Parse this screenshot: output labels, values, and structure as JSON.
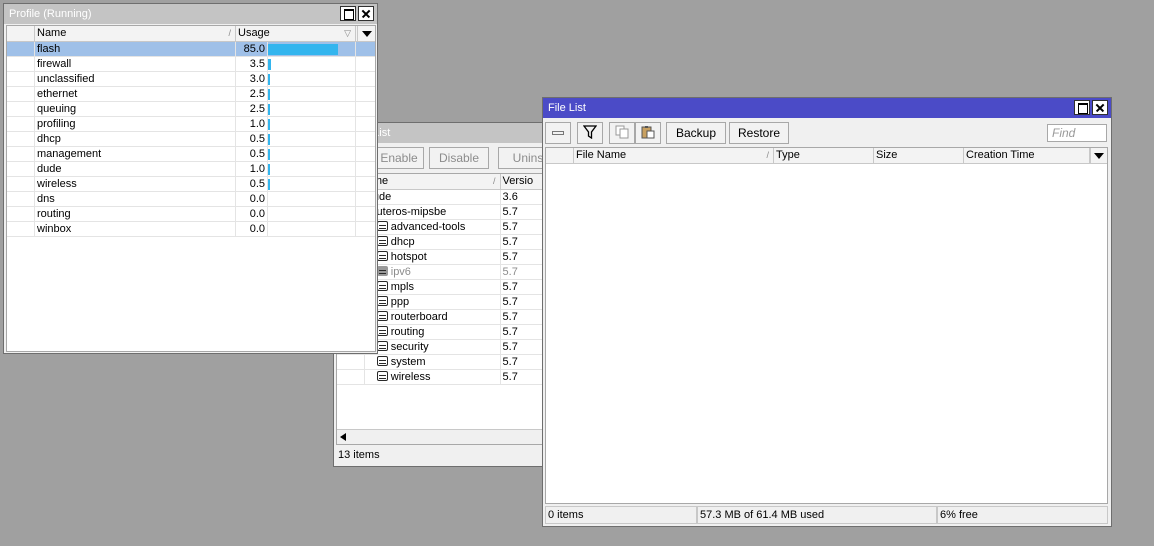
{
  "profile": {
    "title": "Profile (Running)",
    "columns": [
      "Name",
      "Usage"
    ],
    "rows": [
      {
        "name": "flash",
        "usage": "85.0",
        "pct": 85.0,
        "selected": true
      },
      {
        "name": "firewall",
        "usage": "3.5",
        "pct": 3.5
      },
      {
        "name": "unclassified",
        "usage": "3.0",
        "pct": 3.0
      },
      {
        "name": "ethernet",
        "usage": "2.5",
        "pct": 2.5
      },
      {
        "name": "queuing",
        "usage": "2.5",
        "pct": 2.5
      },
      {
        "name": "profiling",
        "usage": "1.0",
        "pct": 1.0
      },
      {
        "name": "dhcp",
        "usage": "0.5",
        "pct": 0.5
      },
      {
        "name": "management",
        "usage": "0.5",
        "pct": 0.5
      },
      {
        "name": "dude",
        "usage": "1.0",
        "pct": 1.0
      },
      {
        "name": "wireless",
        "usage": "0.5",
        "pct": 0.5
      },
      {
        "name": "dns",
        "usage": "0.0",
        "pct": 0.0
      },
      {
        "name": "routing",
        "usage": "0.0",
        "pct": 0.0
      },
      {
        "name": "winbox",
        "usage": "0.0",
        "pct": 0.0
      }
    ],
    "bar_color": "#33b5ee"
  },
  "packages": {
    "title": "e List",
    "buttons": {
      "enable": "Enable",
      "disable": "Disable",
      "uninstall": "Uninsta"
    },
    "columns": [
      "ame",
      "Versio"
    ],
    "rows": [
      {
        "name": "dude",
        "version": "3.6",
        "indent": 0,
        "icon": false,
        "disabled": false
      },
      {
        "name": "routeros-mipsbe",
        "version": "5.7",
        "indent": 0,
        "icon": false,
        "disabled": false
      },
      {
        "name": "advanced-tools",
        "version": "5.7",
        "indent": 1,
        "icon": true,
        "disabled": false
      },
      {
        "name": "dhcp",
        "version": "5.7",
        "indent": 1,
        "icon": true,
        "disabled": false
      },
      {
        "name": "hotspot",
        "version": "5.7",
        "indent": 1,
        "icon": true,
        "disabled": false
      },
      {
        "name": "ipv6",
        "version": "5.7",
        "indent": 1,
        "icon": true,
        "disabled": true
      },
      {
        "name": "mpls",
        "version": "5.7",
        "indent": 1,
        "icon": true,
        "disabled": false
      },
      {
        "name": "ppp",
        "version": "5.7",
        "indent": 1,
        "icon": true,
        "disabled": false
      },
      {
        "name": "routerboard",
        "version": "5.7",
        "indent": 1,
        "icon": true,
        "disabled": false
      },
      {
        "name": "routing",
        "version": "5.7",
        "indent": 1,
        "icon": true,
        "disabled": false
      },
      {
        "name": "security",
        "version": "5.7",
        "indent": 1,
        "icon": true,
        "disabled": false
      },
      {
        "name": "system",
        "version": "5.7",
        "indent": 1,
        "icon": true,
        "disabled": false
      },
      {
        "name": "wireless",
        "version": "5.7",
        "indent": 1,
        "icon": true,
        "disabled": false
      }
    ],
    "status": "13 items"
  },
  "filelist": {
    "title": "File List",
    "buttons": {
      "backup": "Backup",
      "restore": "Restore"
    },
    "find_placeholder": "Find",
    "columns": [
      "File Name",
      "Type",
      "Size",
      "Creation Time"
    ],
    "status": {
      "items": "0 items",
      "usage": "57.3 MB of 61.4 MB used",
      "free": "6% free"
    }
  }
}
